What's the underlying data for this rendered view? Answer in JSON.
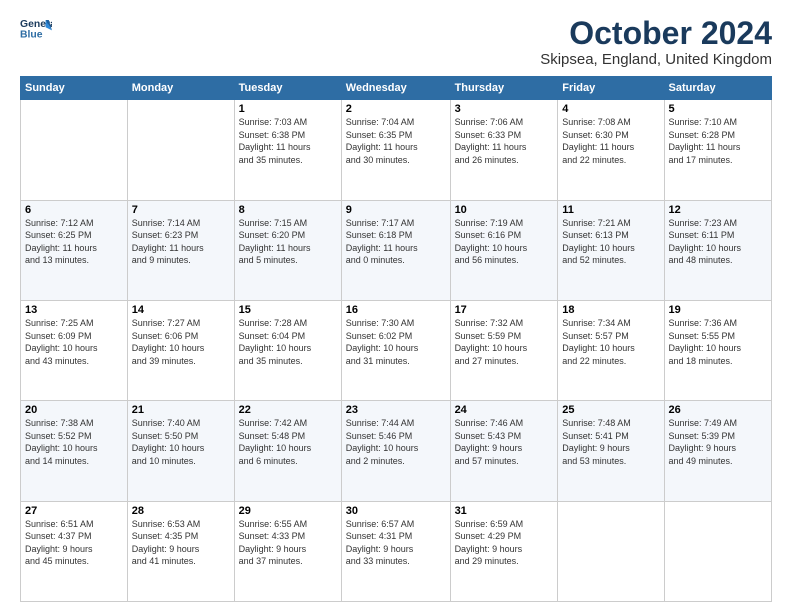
{
  "logo": {
    "line1": "General",
    "line2": "Blue"
  },
  "title": "October 2024",
  "location": "Skipsea, England, United Kingdom",
  "days_of_week": [
    "Sunday",
    "Monday",
    "Tuesday",
    "Wednesday",
    "Thursday",
    "Friday",
    "Saturday"
  ],
  "weeks": [
    [
      {
        "day": "",
        "info": ""
      },
      {
        "day": "",
        "info": ""
      },
      {
        "day": "1",
        "info": "Sunrise: 7:03 AM\nSunset: 6:38 PM\nDaylight: 11 hours\nand 35 minutes."
      },
      {
        "day": "2",
        "info": "Sunrise: 7:04 AM\nSunset: 6:35 PM\nDaylight: 11 hours\nand 30 minutes."
      },
      {
        "day": "3",
        "info": "Sunrise: 7:06 AM\nSunset: 6:33 PM\nDaylight: 11 hours\nand 26 minutes."
      },
      {
        "day": "4",
        "info": "Sunrise: 7:08 AM\nSunset: 6:30 PM\nDaylight: 11 hours\nand 22 minutes."
      },
      {
        "day": "5",
        "info": "Sunrise: 7:10 AM\nSunset: 6:28 PM\nDaylight: 11 hours\nand 17 minutes."
      }
    ],
    [
      {
        "day": "6",
        "info": "Sunrise: 7:12 AM\nSunset: 6:25 PM\nDaylight: 11 hours\nand 13 minutes."
      },
      {
        "day": "7",
        "info": "Sunrise: 7:14 AM\nSunset: 6:23 PM\nDaylight: 11 hours\nand 9 minutes."
      },
      {
        "day": "8",
        "info": "Sunrise: 7:15 AM\nSunset: 6:20 PM\nDaylight: 11 hours\nand 5 minutes."
      },
      {
        "day": "9",
        "info": "Sunrise: 7:17 AM\nSunset: 6:18 PM\nDaylight: 11 hours\nand 0 minutes."
      },
      {
        "day": "10",
        "info": "Sunrise: 7:19 AM\nSunset: 6:16 PM\nDaylight: 10 hours\nand 56 minutes."
      },
      {
        "day": "11",
        "info": "Sunrise: 7:21 AM\nSunset: 6:13 PM\nDaylight: 10 hours\nand 52 minutes."
      },
      {
        "day": "12",
        "info": "Sunrise: 7:23 AM\nSunset: 6:11 PM\nDaylight: 10 hours\nand 48 minutes."
      }
    ],
    [
      {
        "day": "13",
        "info": "Sunrise: 7:25 AM\nSunset: 6:09 PM\nDaylight: 10 hours\nand 43 minutes."
      },
      {
        "day": "14",
        "info": "Sunrise: 7:27 AM\nSunset: 6:06 PM\nDaylight: 10 hours\nand 39 minutes."
      },
      {
        "day": "15",
        "info": "Sunrise: 7:28 AM\nSunset: 6:04 PM\nDaylight: 10 hours\nand 35 minutes."
      },
      {
        "day": "16",
        "info": "Sunrise: 7:30 AM\nSunset: 6:02 PM\nDaylight: 10 hours\nand 31 minutes."
      },
      {
        "day": "17",
        "info": "Sunrise: 7:32 AM\nSunset: 5:59 PM\nDaylight: 10 hours\nand 27 minutes."
      },
      {
        "day": "18",
        "info": "Sunrise: 7:34 AM\nSunset: 5:57 PM\nDaylight: 10 hours\nand 22 minutes."
      },
      {
        "day": "19",
        "info": "Sunrise: 7:36 AM\nSunset: 5:55 PM\nDaylight: 10 hours\nand 18 minutes."
      }
    ],
    [
      {
        "day": "20",
        "info": "Sunrise: 7:38 AM\nSunset: 5:52 PM\nDaylight: 10 hours\nand 14 minutes."
      },
      {
        "day": "21",
        "info": "Sunrise: 7:40 AM\nSunset: 5:50 PM\nDaylight: 10 hours\nand 10 minutes."
      },
      {
        "day": "22",
        "info": "Sunrise: 7:42 AM\nSunset: 5:48 PM\nDaylight: 10 hours\nand 6 minutes."
      },
      {
        "day": "23",
        "info": "Sunrise: 7:44 AM\nSunset: 5:46 PM\nDaylight: 10 hours\nand 2 minutes."
      },
      {
        "day": "24",
        "info": "Sunrise: 7:46 AM\nSunset: 5:43 PM\nDaylight: 9 hours\nand 57 minutes."
      },
      {
        "day": "25",
        "info": "Sunrise: 7:48 AM\nSunset: 5:41 PM\nDaylight: 9 hours\nand 53 minutes."
      },
      {
        "day": "26",
        "info": "Sunrise: 7:49 AM\nSunset: 5:39 PM\nDaylight: 9 hours\nand 49 minutes."
      }
    ],
    [
      {
        "day": "27",
        "info": "Sunrise: 6:51 AM\nSunset: 4:37 PM\nDaylight: 9 hours\nand 45 minutes."
      },
      {
        "day": "28",
        "info": "Sunrise: 6:53 AM\nSunset: 4:35 PM\nDaylight: 9 hours\nand 41 minutes."
      },
      {
        "day": "29",
        "info": "Sunrise: 6:55 AM\nSunset: 4:33 PM\nDaylight: 9 hours\nand 37 minutes."
      },
      {
        "day": "30",
        "info": "Sunrise: 6:57 AM\nSunset: 4:31 PM\nDaylight: 9 hours\nand 33 minutes."
      },
      {
        "day": "31",
        "info": "Sunrise: 6:59 AM\nSunset: 4:29 PM\nDaylight: 9 hours\nand 29 minutes."
      },
      {
        "day": "",
        "info": ""
      },
      {
        "day": "",
        "info": ""
      }
    ]
  ]
}
